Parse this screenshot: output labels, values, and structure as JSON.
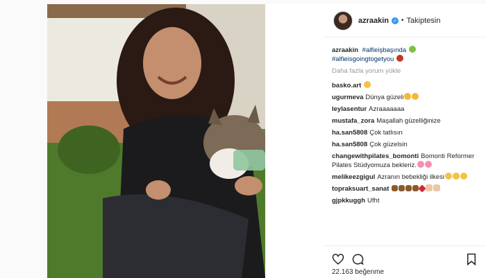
{
  "post": {
    "author": "azraakin",
    "follow_label": "Takiptesin",
    "separator": "•",
    "verified_glyph": "✓",
    "caption": {
      "user": "azraakin",
      "tag1": "#alfieişbaşında",
      "tag2": "#alfieisgoingtogetyou"
    },
    "load_more": "Daha fazla yorum yükle",
    "comments": [
      {
        "user": "basko.art",
        "text": "",
        "emoji": [
          "cat"
        ]
      },
      {
        "user": "ugurmeva",
        "text": "Dünya güzeli",
        "emoji": [
          "heart-eyes",
          "heart-eyes"
        ]
      },
      {
        "user": "leylasentur",
        "text": "Azraaaaaaa",
        "emoji": []
      },
      {
        "user": "mustafa_zora",
        "text": "Maşallah güzelliğinize",
        "emoji": []
      },
      {
        "user": "ha.san5808",
        "text": "Çok tatlısın",
        "emoji": []
      },
      {
        "user": "ha.san5808",
        "text": "Çok güzelsin",
        "emoji": []
      },
      {
        "user": "changewithpilates_bomonti",
        "text": "Bomonti Reformer Pilates Stüdyomuza bekleriz.",
        "emoji": [
          "flower",
          "flower"
        ]
      },
      {
        "user": "melikeezgigul",
        "text": "Azranın bebekliği ilkesi",
        "emoji": [
          "cat",
          "cat",
          "cat"
        ]
      },
      {
        "user": "topraksuart_sanat",
        "text": "",
        "emoji": [
          "paw",
          "paw",
          "paw",
          "paw",
          "heart",
          "hand",
          "hand"
        ]
      },
      {
        "user": "gjpkkuggh",
        "text": "Ufht",
        "emoji": []
      }
    ],
    "likes": "22.163 beğenme"
  },
  "icons": {
    "like": "heart-outline-icon",
    "comment": "comment-bubble-icon",
    "save": "bookmark-icon"
  },
  "colors": {
    "hashtag": "#003569",
    "verified": "#3897f0",
    "muted": "#999999"
  }
}
